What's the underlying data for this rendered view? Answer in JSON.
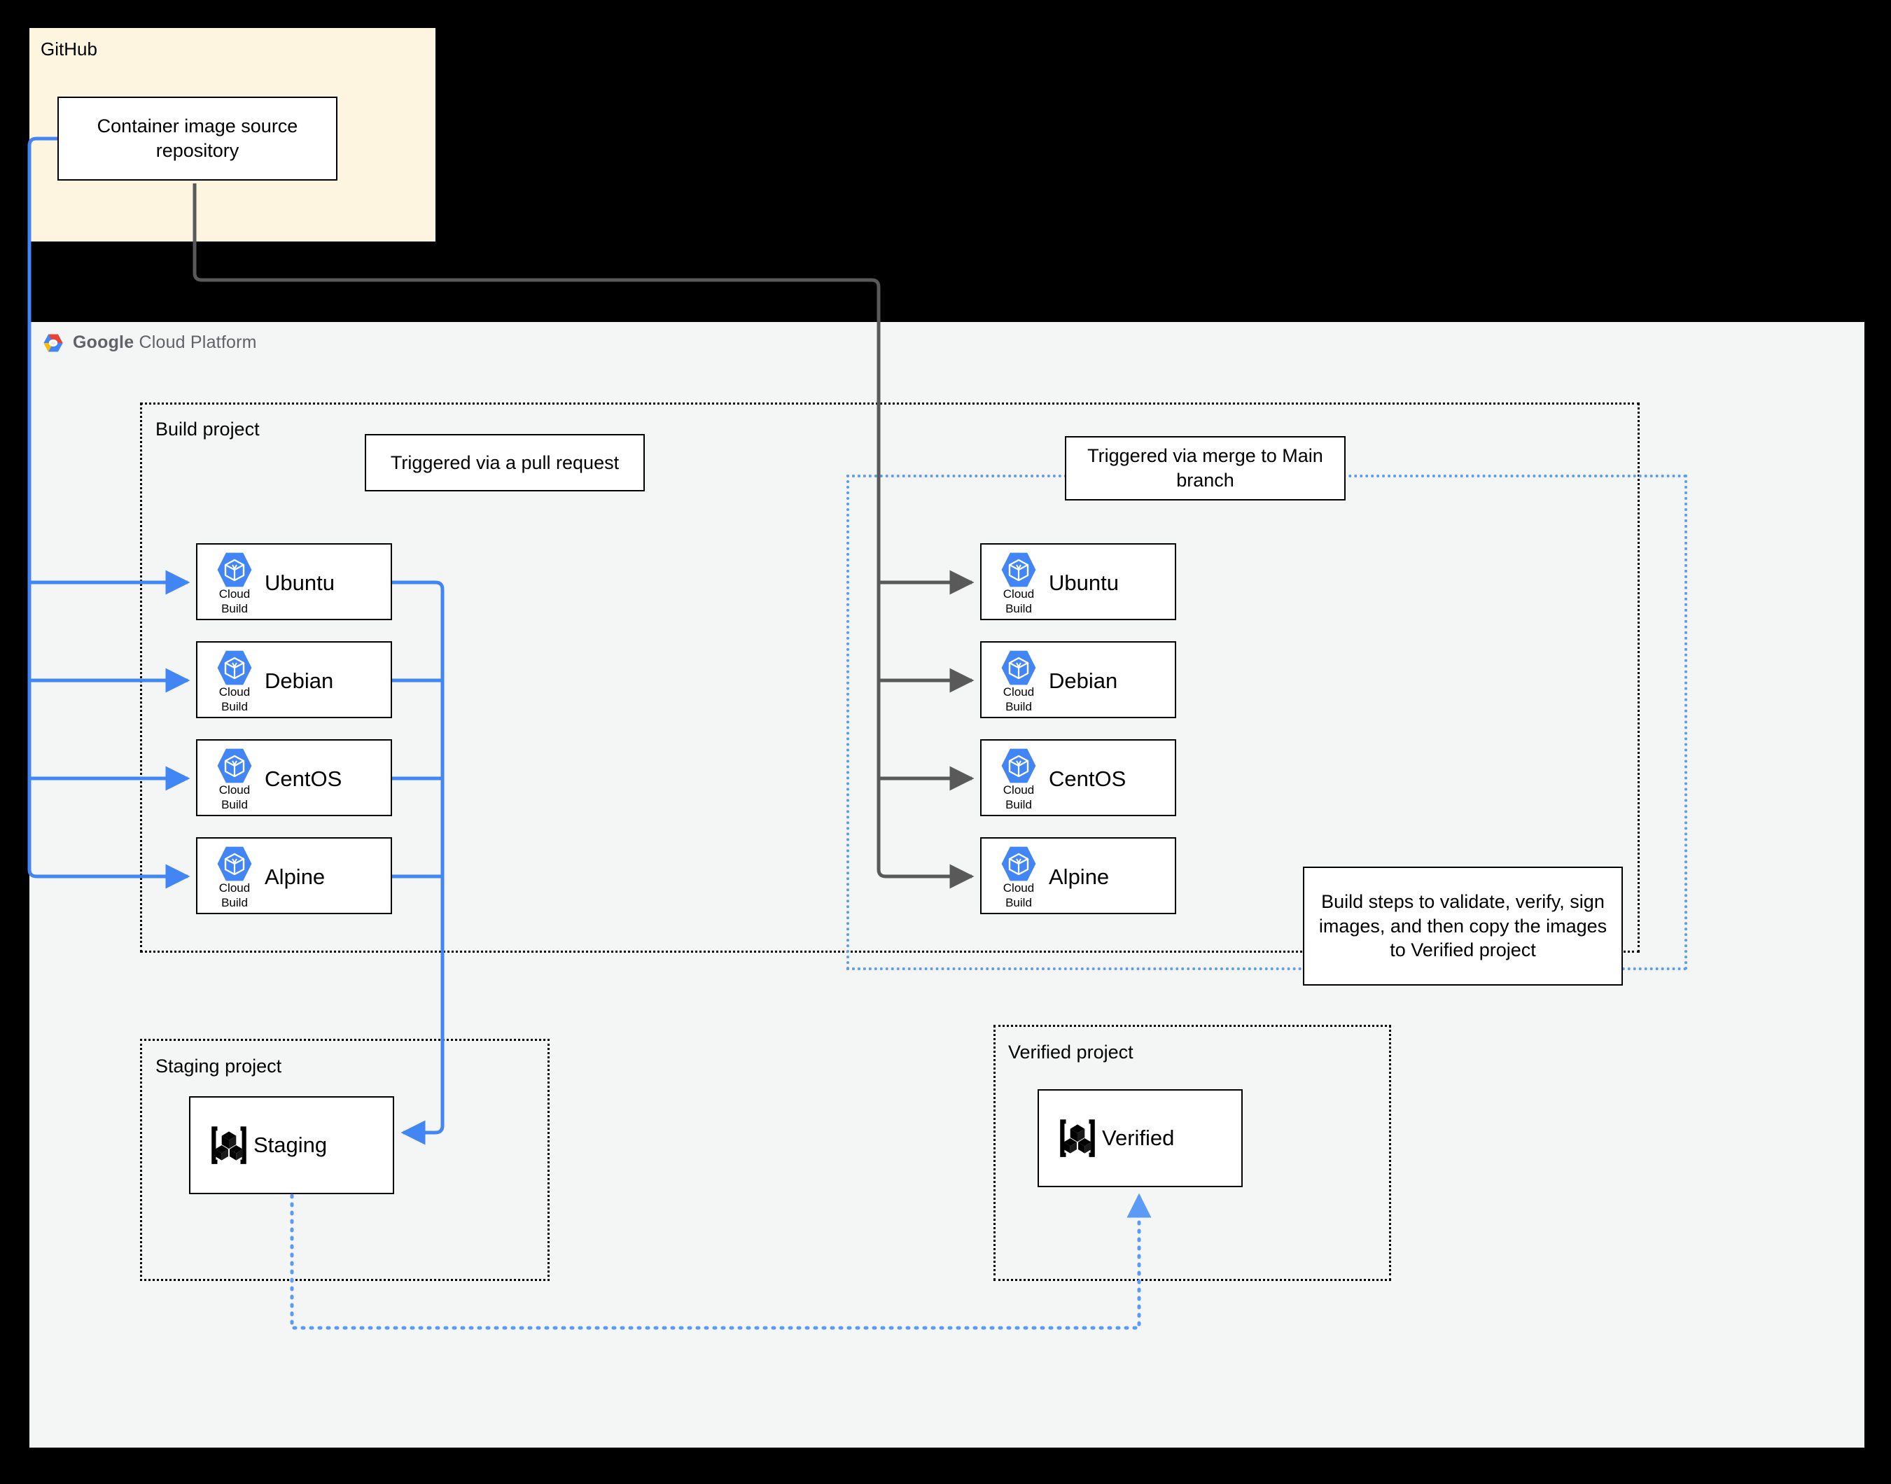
{
  "github": {
    "label": "GitHub",
    "repo_box": "Container image source repository"
  },
  "gcp": {
    "logo_brand": "Google",
    "logo_suffix": "Cloud Platform"
  },
  "groups": {
    "build_project": "Build project",
    "staging_project": "Staging project",
    "verified_project": "Verified project"
  },
  "notes": {
    "pull_request": "Triggered via a pull request",
    "merge_main": "Triggered via merge to Main branch",
    "build_steps": "Build steps to validate, verify, sign images, and then copy the images to Verified project"
  },
  "icons": {
    "cloud_build_sub_line1": "Cloud",
    "cloud_build_sub_line2": "Build",
    "cloud_build_icon": "cloud-build-icon",
    "artifact_registry_icon": "artifact-registry-icon",
    "gcp_logo_icon": "google-cloud-platform-logo-icon"
  },
  "pr_builds": [
    {
      "name": "Ubuntu"
    },
    {
      "name": "Debian"
    },
    {
      "name": "CentOS"
    },
    {
      "name": "Alpine"
    }
  ],
  "main_builds": [
    {
      "name": "Ubuntu"
    },
    {
      "name": "Debian"
    },
    {
      "name": "CentOS"
    },
    {
      "name": "Alpine"
    }
  ],
  "registries": {
    "staging": "Staging",
    "verified": "Verified"
  },
  "colors": {
    "blue_accent": "#4285f4",
    "blue_dotted": "#5b9bf5",
    "gray_arrow": "#595959",
    "github_bg": "#fdf5e0",
    "gcp_bg": "#f4f5f5",
    "cloud_build_hex": "#4285f4"
  }
}
